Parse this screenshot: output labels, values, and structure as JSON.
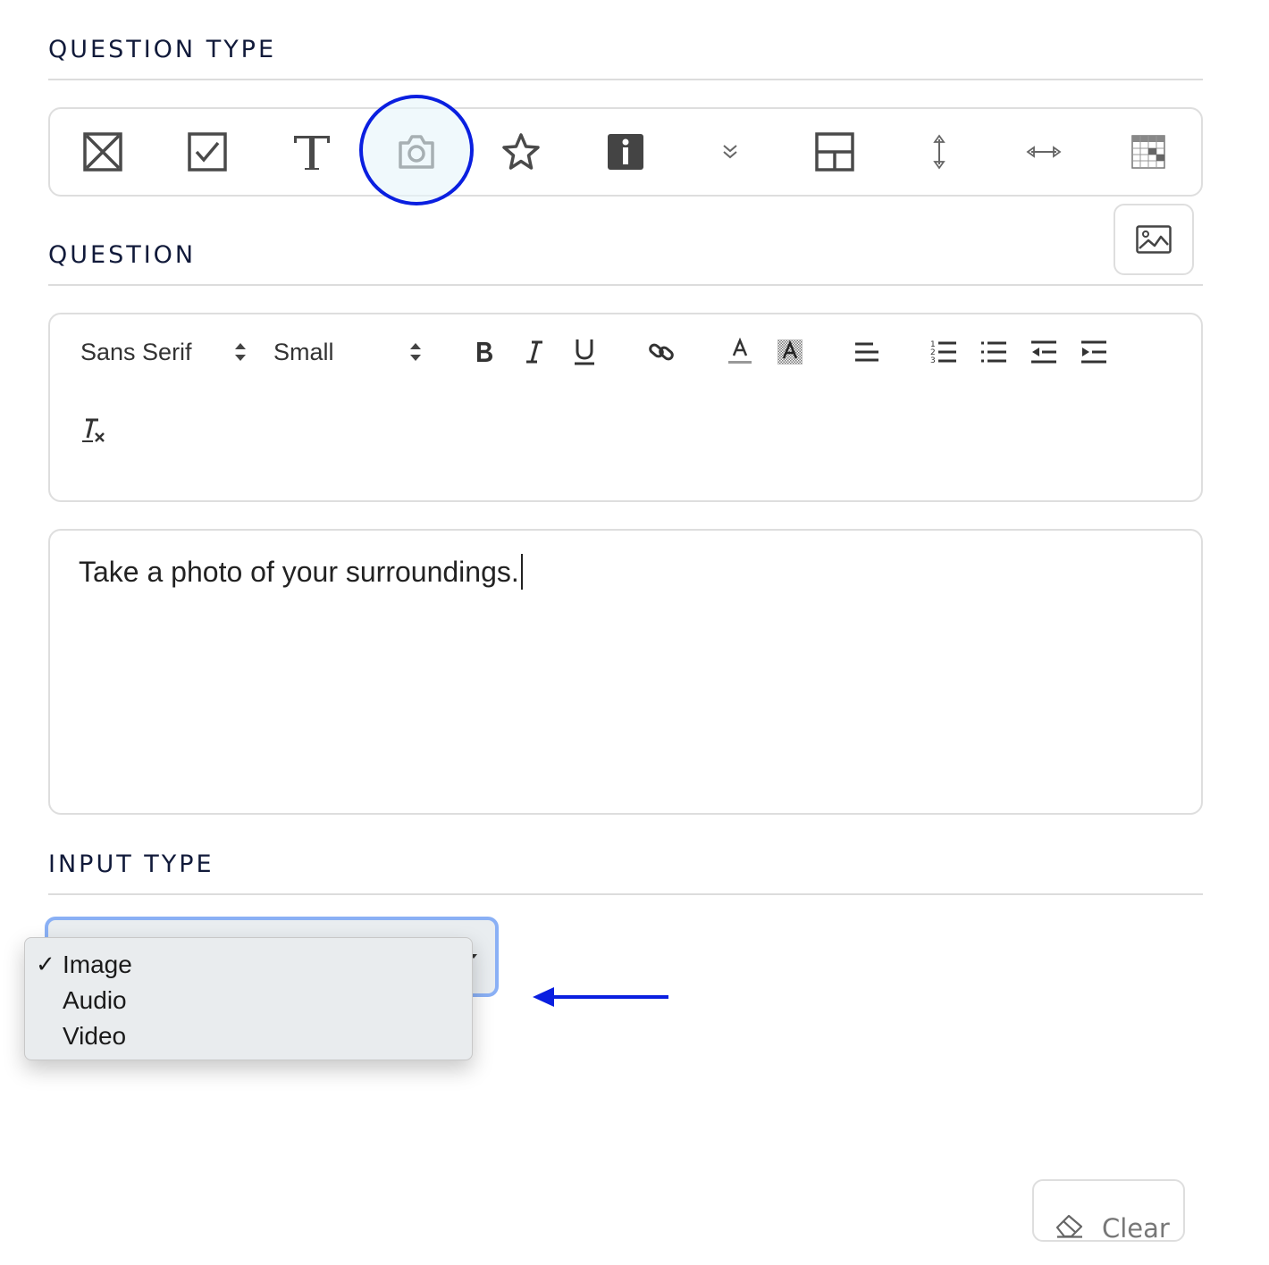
{
  "sections": {
    "question_type": "QUESTION TYPE",
    "question": "QUESTION",
    "input_type": "INPUT TYPE"
  },
  "question_types": [
    {
      "name": "multiple-choice",
      "icon": "box-x-icon"
    },
    {
      "name": "checkbox",
      "icon": "checkbox-icon"
    },
    {
      "name": "text",
      "icon": "text-t-icon"
    },
    {
      "name": "photo",
      "icon": "camera-icon",
      "selected": true
    },
    {
      "name": "rating",
      "icon": "star-icon"
    },
    {
      "name": "info",
      "icon": "info-icon"
    },
    {
      "name": "dropdown",
      "icon": "double-chevron-down-icon"
    },
    {
      "name": "layout",
      "icon": "layout-grid-icon"
    },
    {
      "name": "vertical-slider",
      "icon": "vertical-arrows-icon"
    },
    {
      "name": "horizontal-slider",
      "icon": "horizontal-arrows-icon"
    },
    {
      "name": "matrix",
      "icon": "table-grid-icon"
    }
  ],
  "editor": {
    "font_family": "Sans Serif",
    "font_size": "Small",
    "toolbar": [
      "bold",
      "italic",
      "underline",
      "link",
      "font-color",
      "background-color",
      "align",
      "ordered-list",
      "bullet-list",
      "outdent",
      "indent",
      "clear-format"
    ],
    "content": "Take a photo of your surroundings."
  },
  "input_type": {
    "options": [
      "Image",
      "Audio",
      "Video"
    ],
    "selected": "Image",
    "check": "✓"
  },
  "clear_label": "Clear",
  "colors": {
    "highlight": "#0a1fe0",
    "focus_ring": "#8ab0f5",
    "title": "#111a3a"
  }
}
